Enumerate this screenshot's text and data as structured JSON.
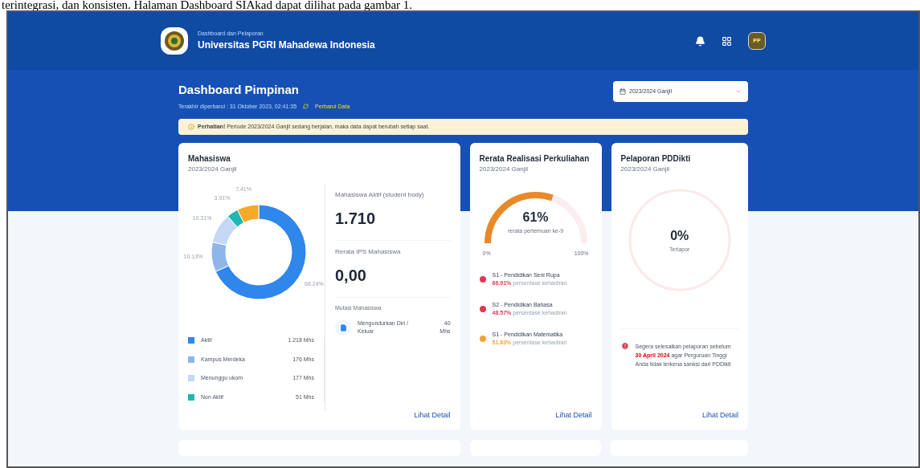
{
  "document_text": "terintegrasi, dan konsisten. Halaman Dashboard SIAkad dapat dilihat pada gambar 1.",
  "header": {
    "subtitle": "Dashboard dan Pelaporan",
    "title": "Universitas PGRI Mahadewa Indonesia",
    "avatar": "PP"
  },
  "page": {
    "title": "Dashboard Pimpinan",
    "updated": "Terakhir diperbarui : 31 Oktober 2023, 02:41:35",
    "refresh": "Perbarui Data",
    "period_select": "2023/2024 Ganjil"
  },
  "alert": {
    "text": "**Perhatian!** Periode 2023/2024 Ganjil sedang berjalan, maka data dapat berubah setiap saat."
  },
  "students_card": {
    "title": "Mahasiswa",
    "period": "2023/2024 Ganjil",
    "chart_data": {
      "type": "donut",
      "values": [
        68.24,
        10.13,
        10.31,
        3.91,
        7.41
      ],
      "value_labels": [
        "68.24%",
        "10.13%",
        "10.31%",
        "3.91%",
        "7.41%"
      ],
      "colors": [
        "#2f86eb",
        "#8fb6ea",
        "#c3d8f4",
        "#1fb8b0",
        "#f4a928"
      ]
    },
    "legend": [
      {
        "label": "Aktif",
        "value": "1.218 Mhs",
        "color": "#2f86eb"
      },
      {
        "label": "Kampus Merdeka",
        "value": "176 Mhs",
        "color": "#8fb6ea"
      },
      {
        "label": "Menunggu ukom",
        "value": "177 Mhs",
        "color": "#c3d8f4"
      },
      {
        "label": "Non Aktif",
        "value": "51 Mhs",
        "color": "#1fb8b0"
      }
    ],
    "active_label": "Mahasiswa Aktif (student body)",
    "active_value": "1.710",
    "ips_label": "Rerata IPS Mahasiswa",
    "ips_value": "0,00",
    "mutation_title": "Mutasi Mahasiswa",
    "mutations": [
      {
        "label": "Mengundurkan Diri / Keluar",
        "value": "40 Mhs"
      }
    ],
    "link": "Lihat Detail"
  },
  "lecture_card": {
    "title": "Rerata Realisasi Perkuliahan",
    "period": "2023/2024 Ganjil",
    "percent": "61%",
    "caption": "rerata pertemuan ke-9",
    "min": "0%",
    "max": "100%",
    "programs": [
      {
        "name": "S1 - Pendidikan Seni Rupa",
        "percent": "66.91%",
        "rest": "persentase kehadiran",
        "color": "#e0394f"
      },
      {
        "name": "S2 - Pendidikan Bahasa",
        "percent": "48.57%",
        "rest": "persentase kehadiran",
        "color": "#e0394f"
      },
      {
        "name": "S1 - Pendidikan Matematika",
        "percent": "51.83%",
        "rest": "persentase kehadiran",
        "color": "#f2a33a"
      }
    ],
    "link": "Lihat Detail"
  },
  "pddikti_card": {
    "title": "Pelaporan PDDikti",
    "period": "2023/2024 Ganjil",
    "percent": "0%",
    "caption": "Terlapor",
    "note": "Segera selesaikan pelaporan sebelum **30 April 2024** agar Perguruan Tinggi Anda tidak terkena sanksi dari PDDikti",
    "link": "Lihat Detail"
  }
}
